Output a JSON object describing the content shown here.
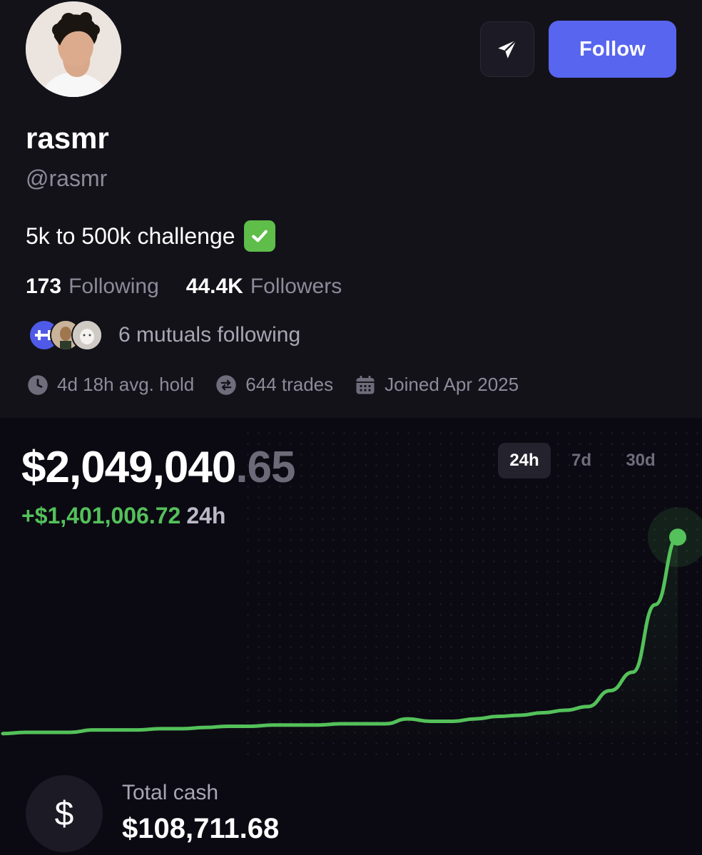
{
  "profile": {
    "name": "rasmr",
    "handle": "@rasmr",
    "bio": "5k to 500k challenge",
    "follow_label": "Follow",
    "following_count": "173",
    "following_label": "Following",
    "followers_count": "44.4K",
    "followers_label": "Followers",
    "mutuals_text": "6 mutuals following",
    "avg_hold": "4d 18h avg. hold",
    "trades": "644 trades",
    "joined": "Joined Apr 2025"
  },
  "portfolio": {
    "balance_main": "$2,049,040",
    "balance_cents": ".65",
    "change_amount": "+$1,401,006.72",
    "change_period": "24h",
    "tabs": [
      "24h",
      "7d",
      "30d"
    ],
    "active_tab": "24h",
    "line_color": "#54c15a"
  },
  "cash": {
    "label": "Total cash",
    "value": "$108,711.68"
  },
  "icons": {
    "send": "send-icon",
    "check": "check-mark-icon",
    "clock": "clock-icon",
    "trades": "swap-icon",
    "calendar": "calendar-icon",
    "dollar": "$"
  },
  "chart_data": {
    "type": "line",
    "title": "",
    "xlabel": "",
    "ylabel": "",
    "series": [
      {
        "values": [
          100,
          101,
          101,
          101,
          103,
          103,
          103,
          104,
          104,
          105,
          106,
          106,
          107,
          107,
          107,
          108,
          108,
          108,
          112,
          110,
          110,
          112,
          114,
          115,
          117,
          119,
          122,
          135,
          150,
          205,
          260
        ]
      }
    ],
    "ylim": [
      90,
      270
    ]
  }
}
